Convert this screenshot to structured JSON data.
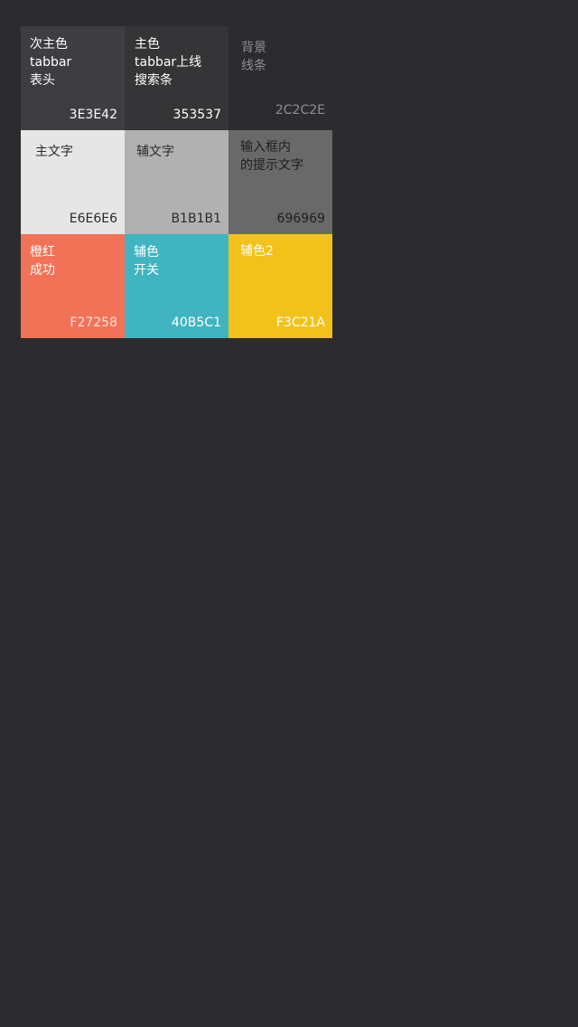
{
  "swatches": [
    {
      "label": "次主色\ntabbar\n表头",
      "hex": "3E3E42",
      "bg": "#3e3e42",
      "fg": "#ffffff",
      "hex_fg": "#ffffff"
    },
    {
      "label": "主色\ntabbar上线\n搜索条",
      "hex": "353537",
      "bg": "#353537",
      "fg": "#ffffff",
      "hex_fg": "#ffffff"
    },
    {
      "label": "背景\n线条",
      "hex": "2C2C2E",
      "bg": "#2c2c2e",
      "fg": "#8e8e92",
      "hex_fg": "#8e8e92"
    },
    {
      "label": "主文字",
      "hex": "E6E6E6",
      "bg": "#e6e6e6",
      "fg": "#2a2a2a",
      "hex_fg": "#2a2a2a"
    },
    {
      "label": "辅文字",
      "hex": "B1B1B1",
      "bg": "#b1b1b1",
      "fg": "#2a2a2a",
      "hex_fg": "#2a2a2a"
    },
    {
      "label": "输入框内\n的提示文字",
      "hex": "696969",
      "bg": "#696969",
      "fg": "#1e1e1e",
      "hex_fg": "#1e1e1e"
    },
    {
      "label": "橙红\n成功",
      "hex": "F27258",
      "bg": "#f27258",
      "fg": "#ffffff",
      "hex_fg": "#ffe3dc"
    },
    {
      "label": "辅色\n开关",
      "hex": "40B5C1",
      "bg": "#40b5c1",
      "fg": "#ffffff",
      "hex_fg": "#ffffff"
    },
    {
      "label": "辅色2",
      "hex": "F3C21A",
      "bg": "#f3c21a",
      "fg": "#ffffff",
      "hex_fg": "#ffffff"
    }
  ]
}
